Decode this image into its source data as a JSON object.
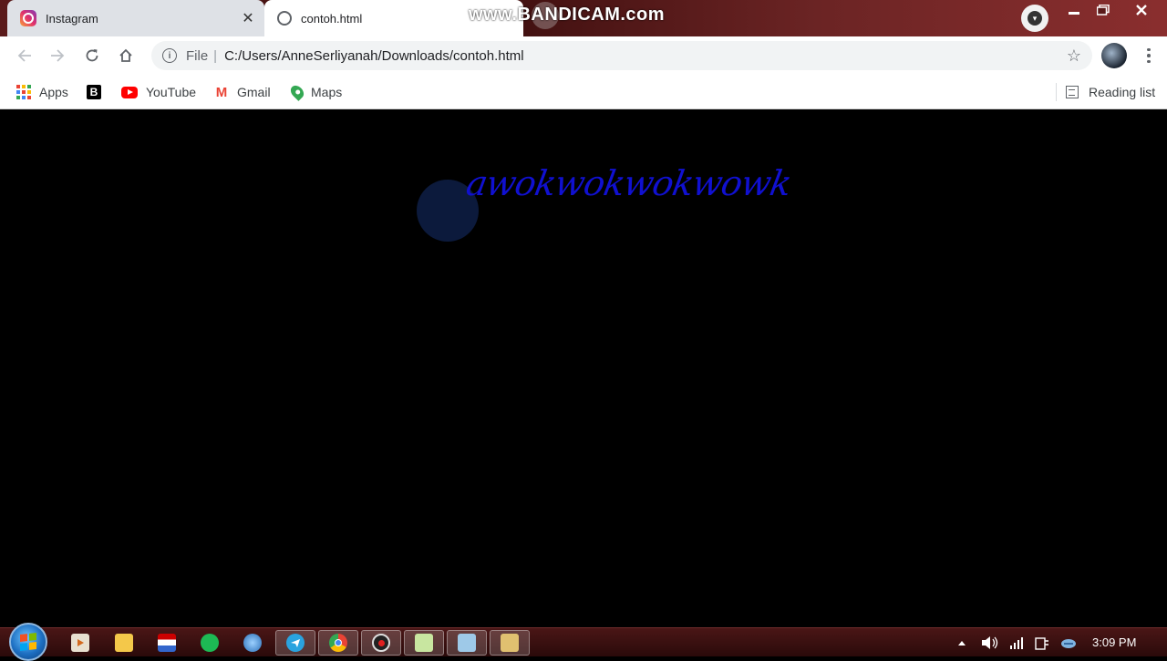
{
  "browser": {
    "tabs": [
      {
        "title": "Instagram",
        "favicon": "instagram-icon",
        "active": false
      },
      {
        "title": "contoh.html",
        "favicon": "globe-icon",
        "active": true
      }
    ],
    "close_glyph": "✕",
    "address": {
      "scheme_label": "File",
      "separator": "|",
      "url": "C:/Users/AnneSerliyanah/Downloads/contoh.html"
    },
    "bookmarks": [
      {
        "label": "Apps",
        "icon": "apps-grid-icon"
      },
      {
        "label": "",
        "icon": "b-logo-icon"
      },
      {
        "label": "YouTube",
        "icon": "youtube-icon"
      },
      {
        "label": "Gmail",
        "icon": "gmail-icon"
      },
      {
        "label": "Maps",
        "icon": "maps-icon"
      }
    ],
    "reading_list": "Reading list"
  },
  "watermark": "www.BANDICAM.com",
  "page": {
    "heading": "awokwokwokwowk",
    "background": "#000000",
    "heading_color": "#1010d0"
  },
  "taskbar": {
    "time": "3:09 PM",
    "apps": [
      "media-player",
      "file-explorer",
      "flag-app",
      "spotify",
      "browser-globe",
      "telegram",
      "chrome",
      "recorder",
      "notepad",
      "window-app",
      "tool-app"
    ]
  }
}
